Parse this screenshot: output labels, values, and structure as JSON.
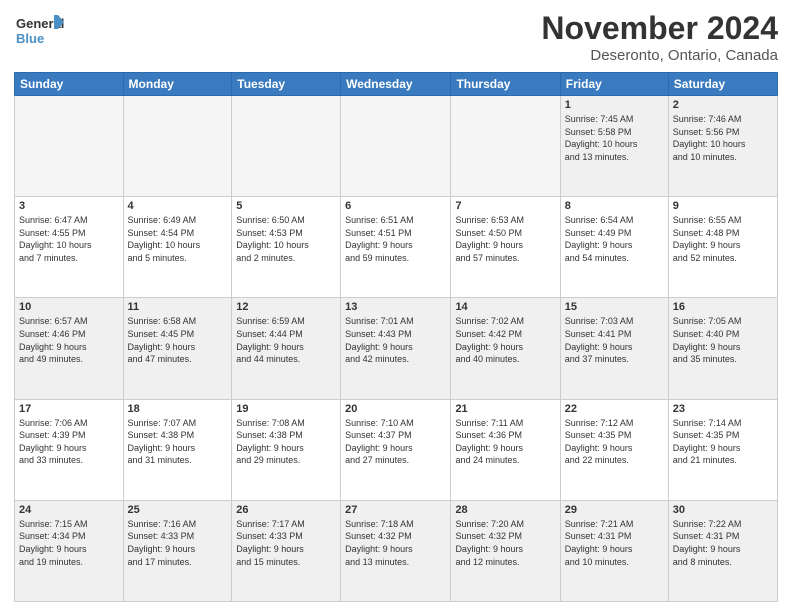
{
  "header": {
    "logo_general": "General",
    "logo_blue": "Blue",
    "month": "November 2024",
    "location": "Deseronto, Ontario, Canada"
  },
  "weekdays": [
    "Sunday",
    "Monday",
    "Tuesday",
    "Wednesday",
    "Thursday",
    "Friday",
    "Saturday"
  ],
  "weeks": [
    [
      {
        "day": "",
        "info": "",
        "empty": true
      },
      {
        "day": "",
        "info": "",
        "empty": true
      },
      {
        "day": "",
        "info": "",
        "empty": true
      },
      {
        "day": "",
        "info": "",
        "empty": true
      },
      {
        "day": "",
        "info": "",
        "empty": true
      },
      {
        "day": "1",
        "info": "Sunrise: 7:45 AM\nSunset: 5:58 PM\nDaylight: 10 hours\nand 13 minutes."
      },
      {
        "day": "2",
        "info": "Sunrise: 7:46 AM\nSunset: 5:56 PM\nDaylight: 10 hours\nand 10 minutes."
      }
    ],
    [
      {
        "day": "3",
        "info": "Sunrise: 6:47 AM\nSunset: 4:55 PM\nDaylight: 10 hours\nand 7 minutes."
      },
      {
        "day": "4",
        "info": "Sunrise: 6:49 AM\nSunset: 4:54 PM\nDaylight: 10 hours\nand 5 minutes."
      },
      {
        "day": "5",
        "info": "Sunrise: 6:50 AM\nSunset: 4:53 PM\nDaylight: 10 hours\nand 2 minutes."
      },
      {
        "day": "6",
        "info": "Sunrise: 6:51 AM\nSunset: 4:51 PM\nDaylight: 9 hours\nand 59 minutes."
      },
      {
        "day": "7",
        "info": "Sunrise: 6:53 AM\nSunset: 4:50 PM\nDaylight: 9 hours\nand 57 minutes."
      },
      {
        "day": "8",
        "info": "Sunrise: 6:54 AM\nSunset: 4:49 PM\nDaylight: 9 hours\nand 54 minutes."
      },
      {
        "day": "9",
        "info": "Sunrise: 6:55 AM\nSunset: 4:48 PM\nDaylight: 9 hours\nand 52 minutes."
      }
    ],
    [
      {
        "day": "10",
        "info": "Sunrise: 6:57 AM\nSunset: 4:46 PM\nDaylight: 9 hours\nand 49 minutes."
      },
      {
        "day": "11",
        "info": "Sunrise: 6:58 AM\nSunset: 4:45 PM\nDaylight: 9 hours\nand 47 minutes."
      },
      {
        "day": "12",
        "info": "Sunrise: 6:59 AM\nSunset: 4:44 PM\nDaylight: 9 hours\nand 44 minutes."
      },
      {
        "day": "13",
        "info": "Sunrise: 7:01 AM\nSunset: 4:43 PM\nDaylight: 9 hours\nand 42 minutes."
      },
      {
        "day": "14",
        "info": "Sunrise: 7:02 AM\nSunset: 4:42 PM\nDaylight: 9 hours\nand 40 minutes."
      },
      {
        "day": "15",
        "info": "Sunrise: 7:03 AM\nSunset: 4:41 PM\nDaylight: 9 hours\nand 37 minutes."
      },
      {
        "day": "16",
        "info": "Sunrise: 7:05 AM\nSunset: 4:40 PM\nDaylight: 9 hours\nand 35 minutes."
      }
    ],
    [
      {
        "day": "17",
        "info": "Sunrise: 7:06 AM\nSunset: 4:39 PM\nDaylight: 9 hours\nand 33 minutes."
      },
      {
        "day": "18",
        "info": "Sunrise: 7:07 AM\nSunset: 4:38 PM\nDaylight: 9 hours\nand 31 minutes."
      },
      {
        "day": "19",
        "info": "Sunrise: 7:08 AM\nSunset: 4:38 PM\nDaylight: 9 hours\nand 29 minutes."
      },
      {
        "day": "20",
        "info": "Sunrise: 7:10 AM\nSunset: 4:37 PM\nDaylight: 9 hours\nand 27 minutes."
      },
      {
        "day": "21",
        "info": "Sunrise: 7:11 AM\nSunset: 4:36 PM\nDaylight: 9 hours\nand 24 minutes."
      },
      {
        "day": "22",
        "info": "Sunrise: 7:12 AM\nSunset: 4:35 PM\nDaylight: 9 hours\nand 22 minutes."
      },
      {
        "day": "23",
        "info": "Sunrise: 7:14 AM\nSunset: 4:35 PM\nDaylight: 9 hours\nand 21 minutes."
      }
    ],
    [
      {
        "day": "24",
        "info": "Sunrise: 7:15 AM\nSunset: 4:34 PM\nDaylight: 9 hours\nand 19 minutes."
      },
      {
        "day": "25",
        "info": "Sunrise: 7:16 AM\nSunset: 4:33 PM\nDaylight: 9 hours\nand 17 minutes."
      },
      {
        "day": "26",
        "info": "Sunrise: 7:17 AM\nSunset: 4:33 PM\nDaylight: 9 hours\nand 15 minutes."
      },
      {
        "day": "27",
        "info": "Sunrise: 7:18 AM\nSunset: 4:32 PM\nDaylight: 9 hours\nand 13 minutes."
      },
      {
        "day": "28",
        "info": "Sunrise: 7:20 AM\nSunset: 4:32 PM\nDaylight: 9 hours\nand 12 minutes."
      },
      {
        "day": "29",
        "info": "Sunrise: 7:21 AM\nSunset: 4:31 PM\nDaylight: 9 hours\nand 10 minutes."
      },
      {
        "day": "30",
        "info": "Sunrise: 7:22 AM\nSunset: 4:31 PM\nDaylight: 9 hours\nand 8 minutes."
      }
    ]
  ]
}
